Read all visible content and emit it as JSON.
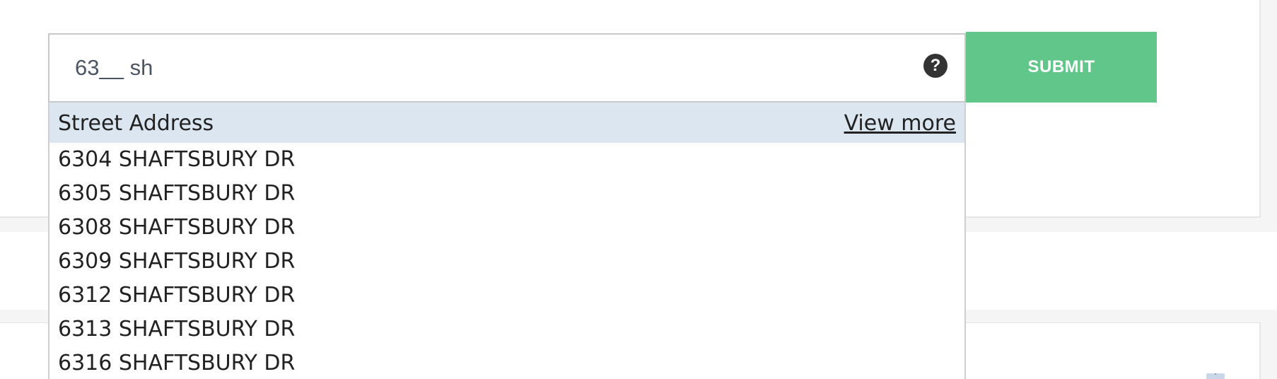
{
  "search": {
    "value": "63__ sh",
    "help_icon": "question-icon"
  },
  "submit": {
    "label": "SUBMIT",
    "color": "#61c68a"
  },
  "dropdown": {
    "header": "Street Address",
    "view_more": "View more",
    "header_color": "#dbe6f1",
    "results": [
      "6304 SHAFTSBURY DR",
      "6305 SHAFTSBURY DR",
      "6308 SHAFTSBURY DR",
      "6309 SHAFTSBURY DR",
      "6312 SHAFTSBURY DR",
      "6313 SHAFTSBURY DR",
      "6316 SHAFTSBURY DR"
    ]
  }
}
